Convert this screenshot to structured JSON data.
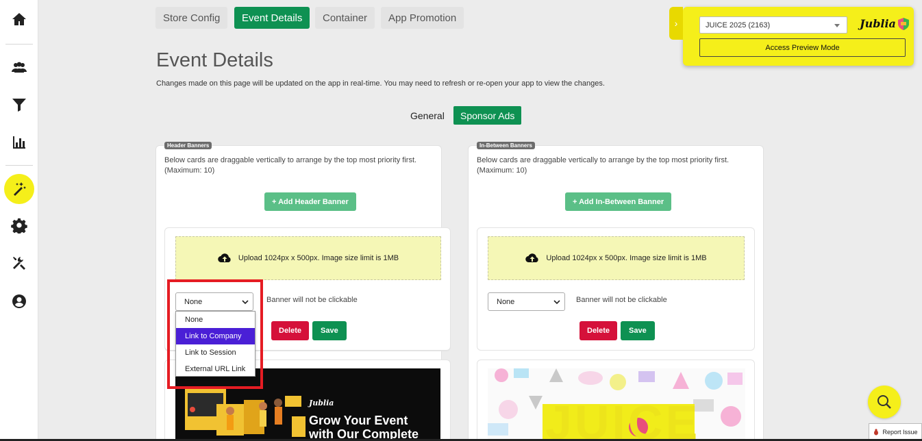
{
  "sidebar": {
    "items": [
      {
        "name": "home-icon"
      },
      {
        "name": "people-icon"
      },
      {
        "name": "filter-icon"
      },
      {
        "name": "bar-chart-icon"
      },
      {
        "name": "magic-wand-icon",
        "active": true
      },
      {
        "name": "gear-icon"
      },
      {
        "name": "tools-icon"
      },
      {
        "name": "user-circle-icon"
      }
    ]
  },
  "tabs": [
    {
      "label": "Store Config"
    },
    {
      "label": "Event Details",
      "active": true
    },
    {
      "label": "Container"
    },
    {
      "label": "App Promotion"
    }
  ],
  "page": {
    "title": "Event Details",
    "description": "Changes made on this page will be updated on the app in real-time. You may need to refresh or re-open your app to view the changes."
  },
  "subtabs": [
    {
      "label": "General"
    },
    {
      "label": "Sponsor Ads",
      "active": true
    }
  ],
  "preview": {
    "event_select": "JUICE 2025 (2163)",
    "logo_text": "Jublia",
    "button_label": "Access Preview Mode"
  },
  "header_panel": {
    "badge": "Header Banners",
    "description": "Below cards are draggable vertically to arrange by the top most priority first. (Maximum: 10)",
    "add_button": "+ Add Header Banner",
    "upload_text": "Upload 1024px x 500px. Image size limit is 1MB",
    "link_select_value": "None",
    "link_note": "Banner will not be clickable",
    "delete_label": "Delete",
    "save_label": "Save"
  },
  "between_panel": {
    "badge": "In-Between Banners",
    "description": "Below cards are draggable vertically to arrange by the top most priority first. (Maximum: 10)",
    "add_button": "+ Add In-Between Banner",
    "upload_text": "Upload 1024px x 500px. Image size limit is 1MB",
    "link_select_value": "None",
    "link_note": "Banner will not be clickable",
    "delete_label": "Delete",
    "save_label": "Save"
  },
  "dropdown": {
    "options": [
      "None",
      "Link to Company",
      "Link to Session",
      "External URL Link"
    ],
    "highlighted": "Link to Company"
  },
  "banner_ad": {
    "logo": "Jublia",
    "headline_1": "Grow Your Event",
    "headline_2": "with Our Complete"
  },
  "juice_banner": {
    "text": "JUICE"
  },
  "report_issue": "Report Issue",
  "colors": {
    "accent_green": "#0e9152",
    "highlight_yellow": "#f5ef1a",
    "delete_red": "#d5113a",
    "dropdown_highlight": "#4a1fd6",
    "annotation_red": "#e51c23"
  }
}
